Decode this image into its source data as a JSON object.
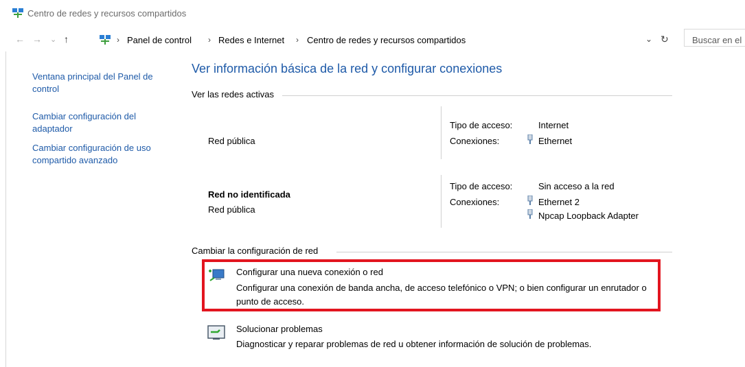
{
  "window": {
    "title": "Centro de redes y recursos compartidos"
  },
  "navigation": {
    "back_label": "←",
    "forward_label": "→",
    "recent_label": "⌄",
    "up_label": "↑"
  },
  "address_bar": {
    "breadcrumbs": [
      "Panel de control",
      "Redes e Internet",
      "Centro de redes y recursos compartidos"
    ],
    "separator": "›",
    "dropdown": "⌄",
    "refresh": "↻"
  },
  "search": {
    "placeholder": "Buscar en el"
  },
  "sidebar": {
    "items": [
      {
        "label": "Ventana principal del Panel de control"
      },
      {
        "label": "Cambiar configuración del adaptador"
      },
      {
        "label": "Cambiar configuración de uso compartido avanzado"
      }
    ]
  },
  "main": {
    "heading": "Ver información básica de la red y configurar conexiones",
    "active_networks_label": "Ver las redes activas",
    "networks": [
      {
        "name": "",
        "category": "Red pública",
        "access_type_label": "Tipo de acceso:",
        "access_type": "Internet",
        "connections_label": "Conexiones:",
        "connections": [
          "Ethernet"
        ]
      },
      {
        "name": "Red no identificada",
        "category": "Red pública",
        "access_type_label": "Tipo de acceso:",
        "access_type": "Sin acceso a la red",
        "connections_label": "Conexiones:",
        "connections": [
          "Ethernet 2",
          "Npcap Loopback Adapter"
        ]
      }
    ],
    "change_settings_label": "Cambiar la configuración de red",
    "tasks": [
      {
        "title": "Configurar una nueva conexión o red",
        "description": "Configurar una conexión de banda ancha, de acceso telefónico o VPN; o bien configurar un enrutador o punto de acceso.",
        "icon": "new-connection-icon"
      },
      {
        "title": "Solucionar problemas",
        "description": "Diagnosticar y reparar problemas de red u obtener información de solución de problemas.",
        "icon": "troubleshoot-icon"
      }
    ]
  },
  "colors": {
    "link": "#0066cc",
    "heading": "#1e5aa8",
    "highlight_border": "#e2151f"
  }
}
